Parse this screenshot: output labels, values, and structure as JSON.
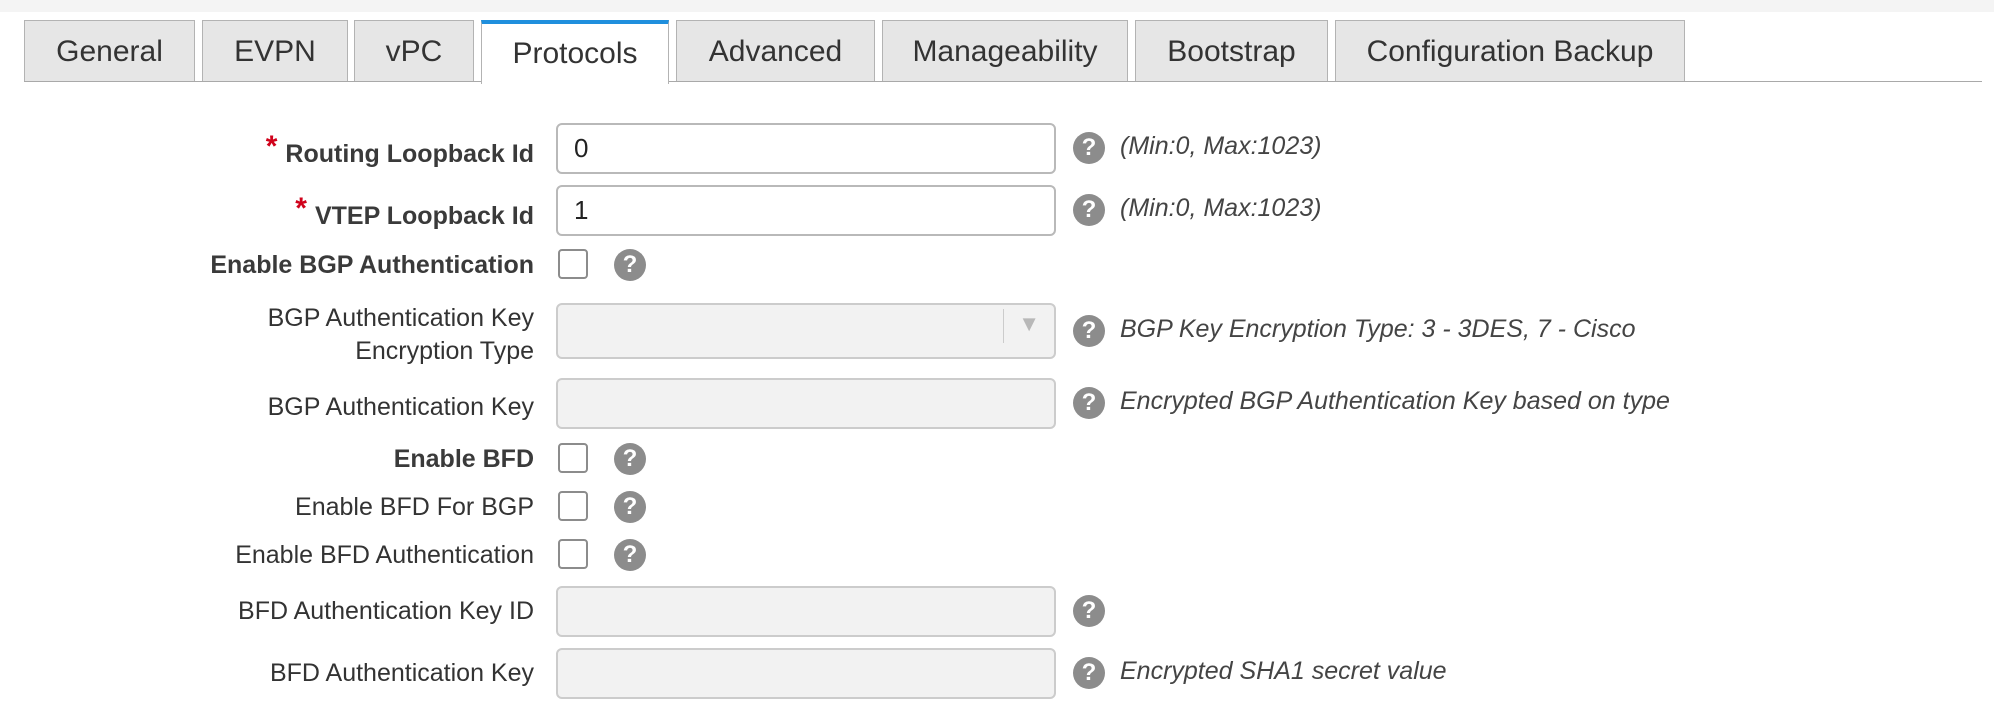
{
  "tabs": [
    {
      "label": "General"
    },
    {
      "label": "EVPN"
    },
    {
      "label": "vPC"
    },
    {
      "label": "Protocols",
      "active": true
    },
    {
      "label": "Advanced"
    },
    {
      "label": "Manageability"
    },
    {
      "label": "Bootstrap"
    },
    {
      "label": "Configuration Backup"
    }
  ],
  "form": {
    "required_marker": "*",
    "routing_loopback": {
      "label": "Routing Loopback Id",
      "value": "0",
      "hint": "(Min:0, Max:1023)"
    },
    "vtep_loopback": {
      "label": "VTEP Loopback Id",
      "value": "1",
      "hint": "(Min:0, Max:1023)"
    },
    "enable_bgp_auth": {
      "label": "Enable BGP Authentication",
      "checked": false
    },
    "bgp_key_enc_type": {
      "label_line1": "BGP Authentication Key",
      "label_line2": "Encryption Type",
      "value": "",
      "hint": "BGP Key Encryption Type: 3 - 3DES, 7 - Cisco"
    },
    "bgp_auth_key": {
      "label": "BGP Authentication Key",
      "value": "",
      "hint": "Encrypted BGP Authentication Key based on type"
    },
    "enable_bfd": {
      "label": "Enable BFD",
      "checked": false
    },
    "enable_bfd_bgp": {
      "label": "Enable BFD For BGP",
      "checked": false
    },
    "enable_bfd_auth": {
      "label": "Enable BFD Authentication",
      "checked": false
    },
    "bfd_auth_key_id": {
      "label": "BFD Authentication Key ID",
      "value": ""
    },
    "bfd_auth_key": {
      "label": "BFD Authentication Key",
      "value": "",
      "hint": "Encrypted SHA1 secret value"
    }
  },
  "help_glyph": "?",
  "dropdown_caret": "▼",
  "colors": {
    "active_tab_accent": "#1f8fdd",
    "required": "#d0021b",
    "help_icon": "#8c8c8c"
  }
}
